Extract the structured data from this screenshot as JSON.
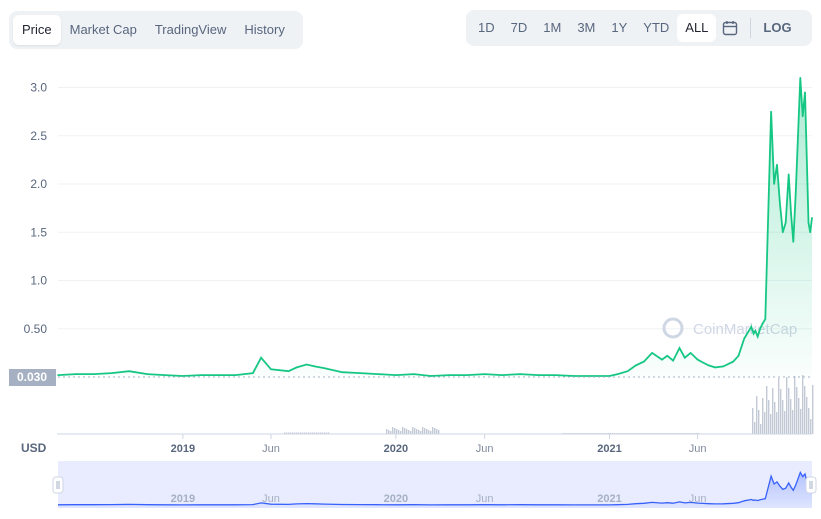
{
  "tabs": [
    {
      "label": "Price",
      "active": true
    },
    {
      "label": "Market Cap",
      "active": false
    },
    {
      "label": "TradingView",
      "active": false
    },
    {
      "label": "History",
      "active": false
    }
  ],
  "ranges": [
    {
      "label": "1D",
      "active": false
    },
    {
      "label": "7D",
      "active": false
    },
    {
      "label": "1M",
      "active": false
    },
    {
      "label": "3M",
      "active": false
    },
    {
      "label": "1Y",
      "active": false
    },
    {
      "label": "YTD",
      "active": false
    },
    {
      "label": "ALL",
      "active": true
    }
  ],
  "calendar_icon": "calendar-icon",
  "log_label": "LOG",
  "currency_label": "USD",
  "current_price_label": "0.030",
  "watermark": "CoinMarketCap",
  "colors": {
    "line": "#16c784",
    "area_top": "#16c784",
    "volume": "#c3cad6",
    "navigator_line": "#3861fb",
    "navigator_bg": "#e8ecfe",
    "price_tag_bg": "#a6b0c3"
  },
  "chart_data": {
    "type": "line",
    "title": "",
    "xlabel": "",
    "ylabel": "",
    "ylim": [
      0,
      3.2
    ],
    "yticks": [
      "0.50",
      "1.0",
      "1.5",
      "2.0",
      "2.5",
      "3.0"
    ],
    "ytick_values": [
      0.5,
      1.0,
      1.5,
      2.0,
      2.5,
      3.0
    ],
    "xticks": [
      {
        "label": "2019",
        "date": "2019-01-01",
        "major": true
      },
      {
        "label": "Jun",
        "date": "2019-06-01",
        "major": false
      },
      {
        "label": "2020",
        "date": "2020-01-01",
        "major": true
      },
      {
        "label": "Jun",
        "date": "2020-06-01",
        "major": false
      },
      {
        "label": "2021",
        "date": "2021-01-01",
        "major": true
      },
      {
        "label": "Jun",
        "date": "2021-06-01",
        "major": false
      }
    ],
    "grid": true,
    "series": [
      {
        "x": [
          "2018-06-01",
          "2018-07-01",
          "2018-08-01",
          "2018-09-01",
          "2018-10-01",
          "2018-11-01",
          "2018-12-01",
          "2019-01-01",
          "2019-02-01",
          "2019-03-01",
          "2019-04-01",
          "2019-05-01",
          "2019-05-15",
          "2019-06-01",
          "2019-07-01",
          "2019-07-15",
          "2019-08-01",
          "2019-08-15",
          "2019-09-01",
          "2019-10-01",
          "2019-11-01",
          "2019-12-01",
          "2020-01-01",
          "2020-02-01",
          "2020-03-01",
          "2020-04-01",
          "2020-05-01",
          "2020-06-01",
          "2020-07-01",
          "2020-08-01",
          "2020-09-01",
          "2020-10-01",
          "2020-11-01",
          "2020-12-01",
          "2021-01-01",
          "2021-01-15",
          "2021-02-01",
          "2021-02-15",
          "2021-03-01",
          "2021-03-15",
          "2021-04-01",
          "2021-04-10",
          "2021-04-20",
          "2021-05-01",
          "2021-05-10",
          "2021-05-20",
          "2021-06-01",
          "2021-06-10",
          "2021-06-20",
          "2021-07-01",
          "2021-07-15",
          "2021-08-01",
          "2021-08-10",
          "2021-08-20",
          "2021-09-01",
          "2021-09-05",
          "2021-09-08",
          "2021-09-12",
          "2021-09-16",
          "2021-09-20",
          "2021-09-25",
          "2021-10-01",
          "2021-10-05",
          "2021-10-10",
          "2021-10-15",
          "2021-10-20",
          "2021-10-25",
          "2021-10-30",
          "2021-11-04",
          "2021-11-08",
          "2021-11-12",
          "2021-11-16",
          "2021-11-20",
          "2021-11-24",
          "2021-11-28",
          "2021-12-02",
          "2021-12-05",
          "2021-12-08",
          "2021-12-11",
          "2021-12-14"
        ],
        "y": [
          0.02,
          0.03,
          0.03,
          0.04,
          0.06,
          0.03,
          0.02,
          0.01,
          0.02,
          0.02,
          0.02,
          0.04,
          0.2,
          0.08,
          0.06,
          0.1,
          0.13,
          0.11,
          0.09,
          0.05,
          0.04,
          0.03,
          0.02,
          0.03,
          0.01,
          0.02,
          0.02,
          0.03,
          0.02,
          0.03,
          0.02,
          0.02,
          0.01,
          0.01,
          0.01,
          0.03,
          0.06,
          0.12,
          0.16,
          0.25,
          0.18,
          0.22,
          0.17,
          0.3,
          0.2,
          0.25,
          0.18,
          0.15,
          0.12,
          0.1,
          0.11,
          0.16,
          0.22,
          0.4,
          0.52,
          0.45,
          0.48,
          0.42,
          0.5,
          0.55,
          0.6,
          1.9,
          2.75,
          2.0,
          2.2,
          1.8,
          1.5,
          1.6,
          2.1,
          1.7,
          1.4,
          1.9,
          2.5,
          3.1,
          2.7,
          2.95,
          2.3,
          1.6,
          1.5,
          1.65
        ]
      }
    ]
  }
}
